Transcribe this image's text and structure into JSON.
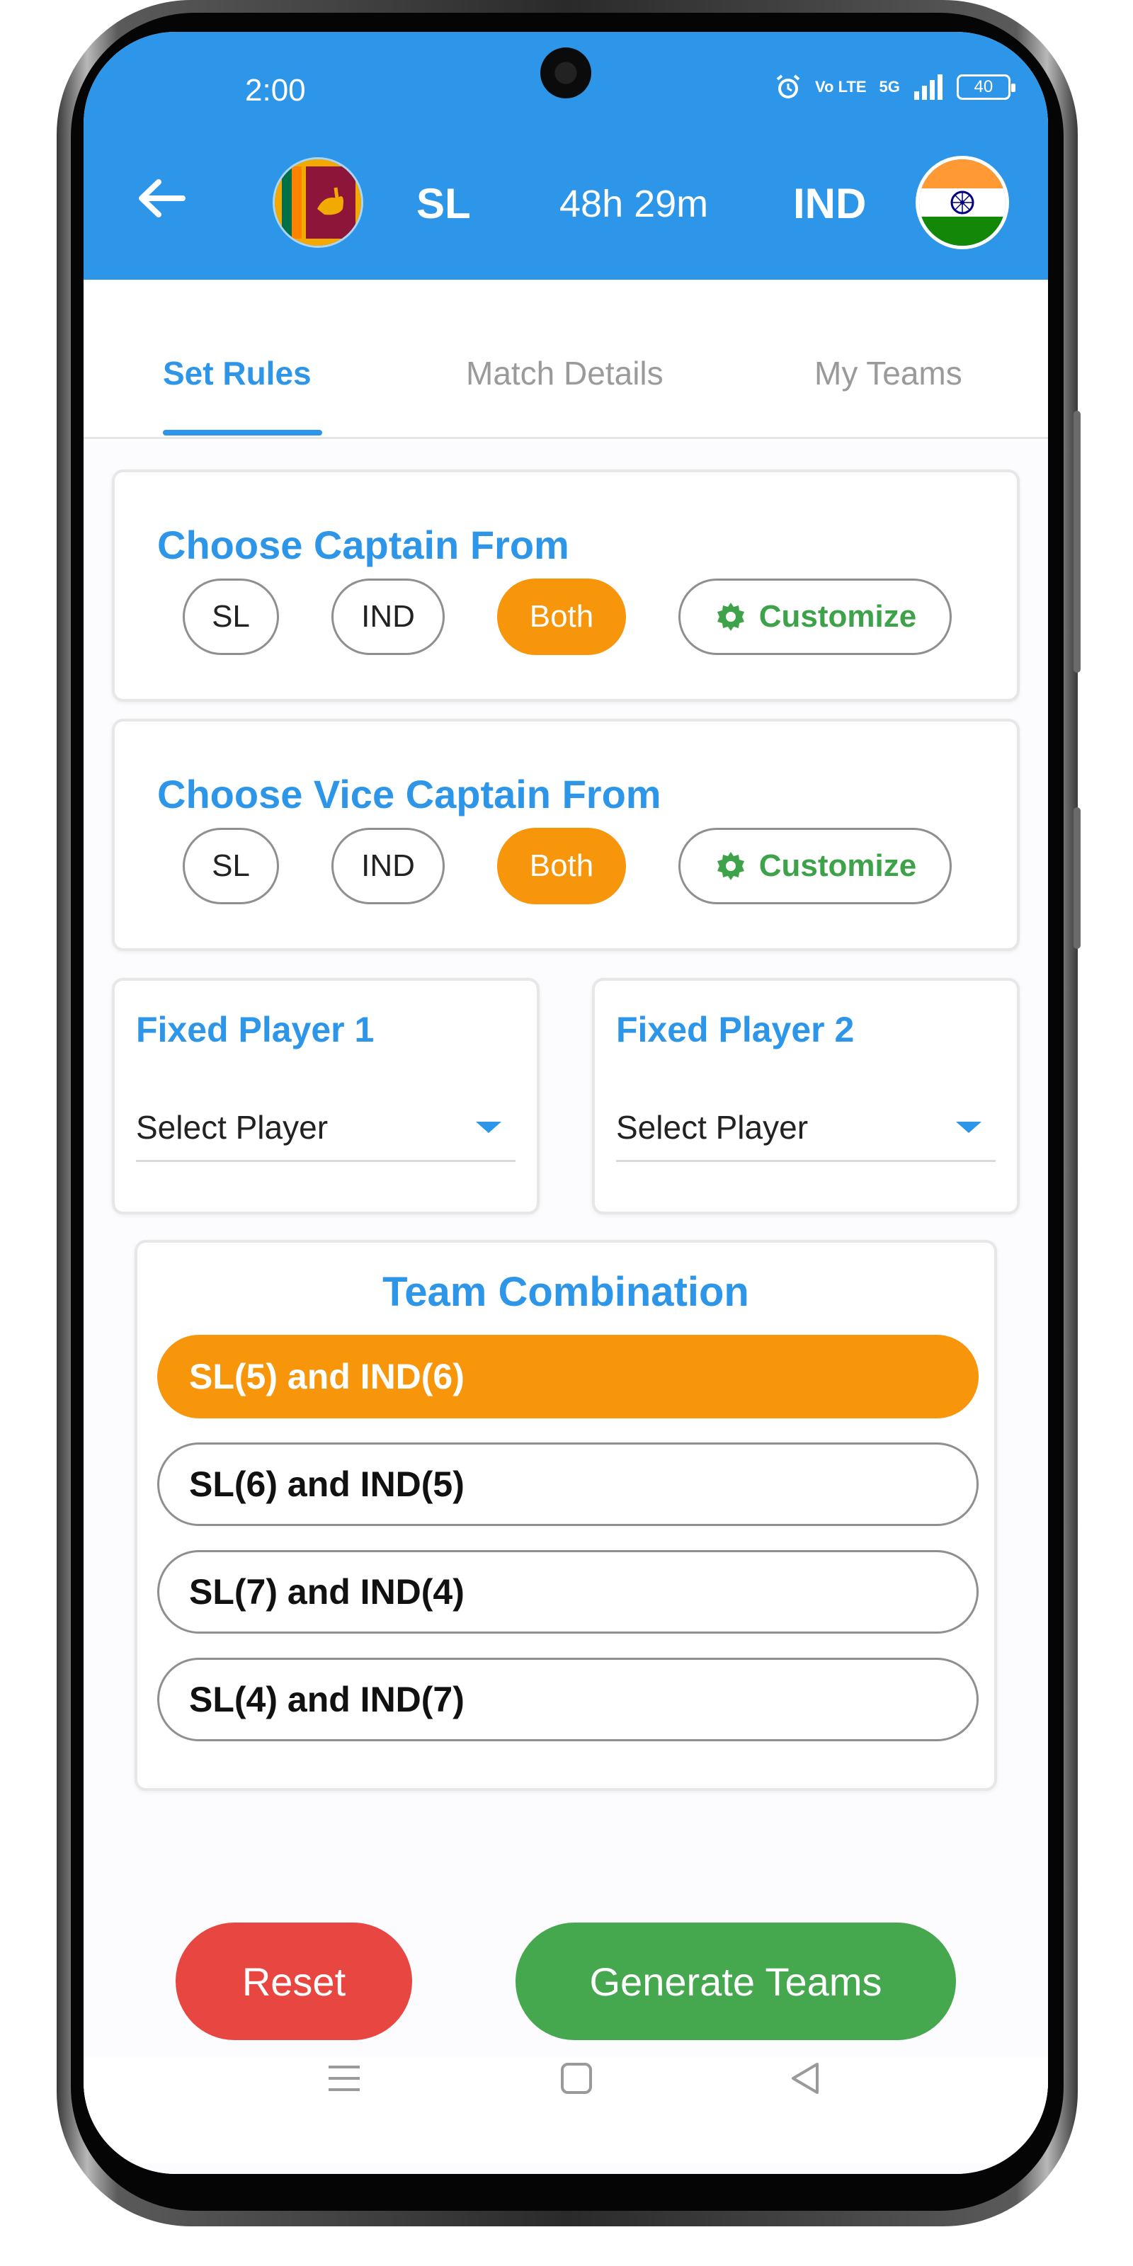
{
  "status_bar": {
    "time": "2:00",
    "network_label": "5G",
    "volte_label": "Vo LTE",
    "battery": "40",
    "icons": [
      "alarm-icon",
      "volte-icon",
      "signal-icon",
      "battery-icon"
    ]
  },
  "header": {
    "team_left": "SL",
    "countdown": "48h 29m",
    "team_right": "IND",
    "icons": [
      "back-arrow-icon",
      "sri-lanka-flag",
      "india-flag"
    ]
  },
  "tabs": [
    "Set Rules",
    "Match Details",
    "My Teams"
  ],
  "captain": {
    "title": "Choose Captain From",
    "options": [
      "SL",
      "IND",
      "Both"
    ],
    "selected": "Both",
    "customize_label": "Customize"
  },
  "vice_captain": {
    "title": "Choose Vice Captain From",
    "options": [
      "SL",
      "IND",
      "Both"
    ],
    "selected": "Both",
    "customize_label": "Customize"
  },
  "fixed_players": [
    {
      "title": "Fixed Player 1",
      "value": "Select Player"
    },
    {
      "title": "Fixed Player 2",
      "value": "Select Player"
    }
  ],
  "team_combination": {
    "title": "Team Combination",
    "options": [
      "SL(5) and IND(6)",
      "SL(6) and IND(5)",
      "SL(7) and IND(4)",
      "SL(4) and IND(7)"
    ],
    "selected": "SL(5) and IND(6)"
  },
  "actions": {
    "reset": "Reset",
    "generate": "Generate Teams"
  },
  "colors": {
    "primary_blue": "#2e96e8",
    "selected_orange": "#f7960a",
    "reset_red": "#e84640",
    "generate_green": "#45a84e",
    "customize_green": "#3ea24a"
  },
  "system_nav": [
    "menu-icon",
    "home-icon",
    "back-icon"
  ]
}
